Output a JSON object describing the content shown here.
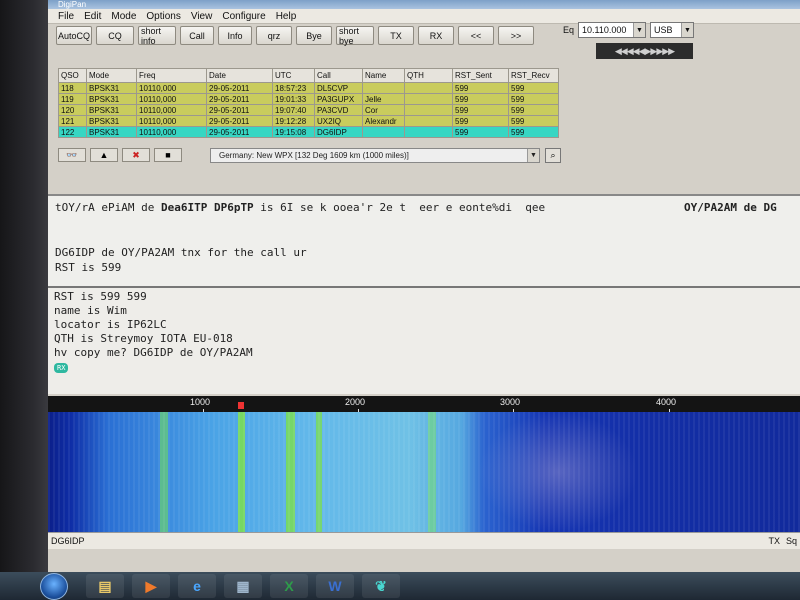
{
  "window": {
    "title": "DigiPan"
  },
  "menu": [
    "File",
    "Edit",
    "Mode",
    "Options",
    "View",
    "Configure",
    "Help"
  ],
  "toolbar": [
    "AutoCQ",
    "CQ",
    "short info",
    "Call",
    "Info",
    "qrz",
    "Bye",
    "short bye",
    "TX",
    "RX",
    "<<",
    ">>"
  ],
  "eq": {
    "label": "Eq",
    "frequency": "10.110.000",
    "mode": "USB"
  },
  "tuner_display": "◀◀◀◀◀▶▶▶▶▶",
  "qso_table": {
    "headers": [
      "QSO",
      "Mode",
      "Freq",
      "Date",
      "UTC",
      "Call",
      "Name",
      "QTH",
      "RST_Sent",
      "RST_Recv"
    ],
    "rows": [
      [
        "118",
        "BPSK31",
        "10110,000",
        "29-05-2011",
        "18:57:23",
        "DL5CVP",
        "",
        "",
        "599",
        "599"
      ],
      [
        "119",
        "BPSK31",
        "10110,000",
        "29-05-2011",
        "19:01:33",
        "PA3GUPX",
        "Jelle",
        "",
        "599",
        "599"
      ],
      [
        "120",
        "BPSK31",
        "10110,000",
        "29-05-2011",
        "19:07:40",
        "PA3CVD",
        "Cor",
        "",
        "599",
        "599"
      ],
      [
        "121",
        "BPSK31",
        "10110,000",
        "29-05-2011",
        "19:12:28",
        "UX2IQ",
        "Alexandr",
        "",
        "599",
        "599"
      ],
      [
        "122",
        "BPSK31",
        "10110,000",
        "29-05-2011",
        "19:15:08",
        "DG6IDP",
        "",
        "",
        "599",
        "599"
      ]
    ]
  },
  "location": "Germany: New WPX [132 Deg 1609 km (1000 miles)]",
  "rx_text": {
    "line1": "tOY/rA ePiAM de ",
    "line1_bold": "Dea6ITP DP6pTP",
    "line1_rest": " is 6I se k ooea'r 2e t  eer e eonte%di  qee",
    "line1_right": "OY/PA2AM de DG",
    "line2": "DG6IDP de OY/PA2AM tnx for the call ur",
    "line3": "RST is 599"
  },
  "tx_text": {
    "line1": "RST is 599 599",
    "line2": "name is Wim",
    "line3": "locator is IP62LC",
    "line4": "QTH is Streymoy IOTA EU-018",
    "line5": "hv copy me? DG6IDP de OY/PA2AM",
    "tag": "RX"
  },
  "scale_labels": [
    "1000",
    "2000",
    "3000",
    "4000"
  ],
  "status": {
    "call": "DG6IDP",
    "tx": "TX",
    "sq": "Sq"
  },
  "colors": {
    "logged_row": "#c9cc5d",
    "current_row": "#37d6c3",
    "waterfall_signal": "#7de04a"
  }
}
